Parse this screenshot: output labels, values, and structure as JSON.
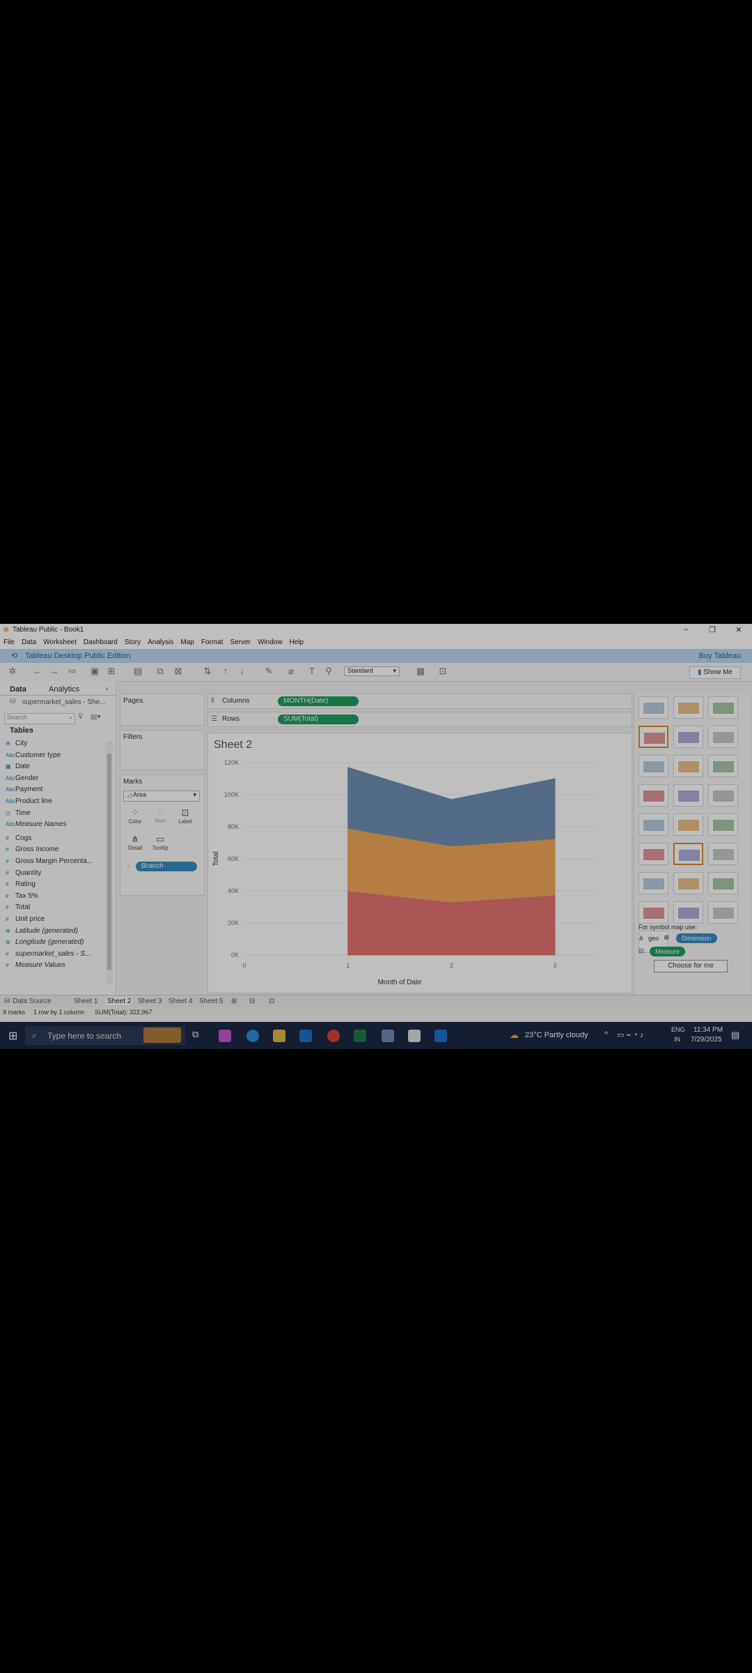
{
  "window": {
    "title": "Tableau Public - Book1"
  },
  "menu": [
    "File",
    "Data",
    "Worksheet",
    "Dashboard",
    "Story",
    "Analysis",
    "Map",
    "Format",
    "Server",
    "Window",
    "Help"
  ],
  "banner": {
    "edition": "Tableau Desktop Public Edition",
    "buy": "Buy Tableau"
  },
  "toolbar": {
    "fit": "Standard",
    "show_me": "Show Me"
  },
  "datapane": {
    "tab_data": "Data",
    "tab_analytics": "Analytics",
    "datasource": "supermarket_sales - She...",
    "search_placeholder": "Search",
    "tables_header": "Tables",
    "dimensions": [
      {
        "icon": "geo",
        "name": "City"
      },
      {
        "icon": "Abc",
        "name": "Customer type"
      },
      {
        "icon": "date",
        "name": "Date"
      },
      {
        "icon": "Abc",
        "name": "Gender"
      },
      {
        "icon": "Abc",
        "name": "Payment"
      },
      {
        "icon": "Abc",
        "name": "Product line"
      },
      {
        "icon": "time",
        "name": "Time"
      },
      {
        "icon": "Abc",
        "name": "Measure Names"
      }
    ],
    "measures": [
      {
        "icon": "#",
        "name": "Cogs"
      },
      {
        "icon": "#",
        "name": "Gross Income"
      },
      {
        "icon": "#",
        "name": "Gross Margin Percenta..."
      },
      {
        "icon": "#",
        "name": "Quantity"
      },
      {
        "icon": "#",
        "name": "Rating"
      },
      {
        "icon": "#",
        "name": "Tax 5%"
      },
      {
        "icon": "#",
        "name": "Total"
      },
      {
        "icon": "#",
        "name": "Unit price"
      },
      {
        "icon": "geo",
        "name": "Latitude (generated)"
      },
      {
        "icon": "geo",
        "name": "Longitude (generated)"
      },
      {
        "icon": "#",
        "name": "supermarket_sales - S..."
      },
      {
        "icon": "#",
        "name": "Measure Values"
      }
    ]
  },
  "cards": {
    "pages": "Pages",
    "filters": "Filters",
    "marks": "Marks",
    "mark_type": "Area",
    "buttons": {
      "color": "Color",
      "size": "Size",
      "label": "Label",
      "detail": "Detail",
      "tooltip": "Tooltip"
    },
    "color_pill": "Branch"
  },
  "shelves": {
    "columns_label": "Columns",
    "columns_pill": "MONTH(Date)",
    "rows_label": "Rows",
    "rows_pill": "SUM(Total)"
  },
  "sheet_title": "Sheet 2",
  "chart_data": {
    "type": "area",
    "stacked": true,
    "x": [
      1,
      2,
      3
    ],
    "xlabel": "Month of Date",
    "ylabel": "Total",
    "xlim": [
      0,
      3
    ],
    "ylim": [
      0,
      120000
    ],
    "xticks": [
      "0",
      "1",
      "2",
      "3"
    ],
    "yticks": [
      "0K",
      "20K",
      "40K",
      "60K",
      "80K",
      "100K",
      "120K"
    ],
    "grid": true,
    "series": [
      {
        "values": [
          40000,
          33000,
          37500
        ],
        "color": "#e57373"
      },
      {
        "values": [
          39000,
          35000,
          35000
        ],
        "color": "#f0a858"
      },
      {
        "values": [
          38000,
          29000,
          37500
        ],
        "color": "#6f8fb3"
      }
    ]
  },
  "showme": {
    "hint": "For symbol map use:",
    "geo_label": "geo",
    "dimension": "Dimension",
    "measure": "Measure",
    "choose": "Choose for me"
  },
  "sheet_tabs": [
    "Data Source",
    "Sheet 1",
    "Sheet 2",
    "Sheet 3",
    "Sheet 4",
    "Sheet 5"
  ],
  "active_tab": "Sheet 2",
  "status": {
    "marks": "9 marks",
    "rowscols": "1 row by 1 column",
    "sum": "SUM(Total): 322,967"
  },
  "taskbar": {
    "search": "Type here to search",
    "weather": "23°C  Partly cloudy",
    "lang1": "ENG",
    "lang2": "IN",
    "time": "11:34 PM",
    "date": "7/29/2025"
  },
  "colors": {
    "green_pill": "#1e9e5e",
    "blue_pill": "#3a8bbf",
    "banner": "#bcd7ee",
    "taskbar": "#1c2740"
  }
}
